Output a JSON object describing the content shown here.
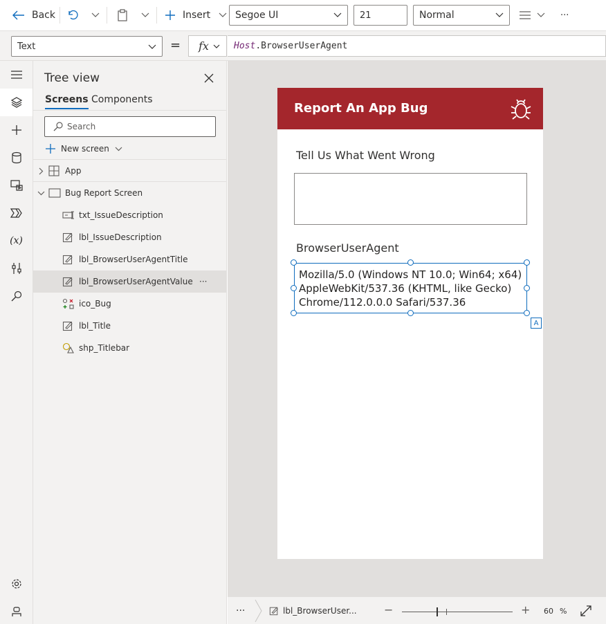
{
  "colors": {
    "accent": "#0f6cbd",
    "titlebar": "#a4262c",
    "panel_bg": "#f3f2f1",
    "canvas_bg": "#e1dfdd",
    "formula_keyword": "#742774"
  },
  "toolbar": {
    "back_label": "Back",
    "insert_label": "Insert",
    "font_value": "Segoe UI",
    "font_size_value": "21",
    "font_weight_value": "Normal",
    "more_label": "···"
  },
  "formula_bar": {
    "property_value": "Text",
    "equals": "=",
    "fx_label": "fx",
    "formula_object": "Host",
    "formula_member": ".BrowserUserAgent"
  },
  "tree_view": {
    "title": "Tree view",
    "tabs": [
      "Screens",
      "Components"
    ],
    "active_tab": "Screens",
    "search_placeholder": "Search",
    "new_screen_label": "New screen",
    "app_label": "App",
    "screen_label": "Bug Report Screen",
    "items": [
      {
        "label": "txt_IssueDescription",
        "icon": "text-input-icon"
      },
      {
        "label": "lbl_IssueDescription",
        "icon": "label-edit-icon"
      },
      {
        "label": "lbl_BrowserUserAgentTitle",
        "icon": "label-edit-icon"
      },
      {
        "label": "lbl_BrowserUserAgentValue",
        "icon": "label-edit-icon",
        "selected": true
      },
      {
        "label": "ico_Bug",
        "icon": "icons-icon"
      },
      {
        "label": "lbl_Title",
        "icon": "label-edit-icon"
      },
      {
        "label": "shp_Titlebar",
        "icon": "shape-icon"
      }
    ],
    "row_more": "···"
  },
  "app_screen": {
    "title": "Report An App Bug",
    "issue_label": "Tell Us What Went Wrong",
    "bua_title": "BrowserUserAgent",
    "bua_value_line1": "Mozilla/5.0 (Windows NT 10.0; Win64; x64)",
    "bua_value_line2": "AppleWebKit/537.36 (KHTML, like Gecko)",
    "bua_value_line3": "Chrome/112.0.0.0 Safari/537.36",
    "badge": "A"
  },
  "status_bar": {
    "more": "···",
    "breadcrumb": "lbl_BrowserUser...",
    "zoom_minus": "−",
    "zoom_plus": "+",
    "zoom_value": "60",
    "zoom_unit": "%",
    "zoom_level": 60
  }
}
